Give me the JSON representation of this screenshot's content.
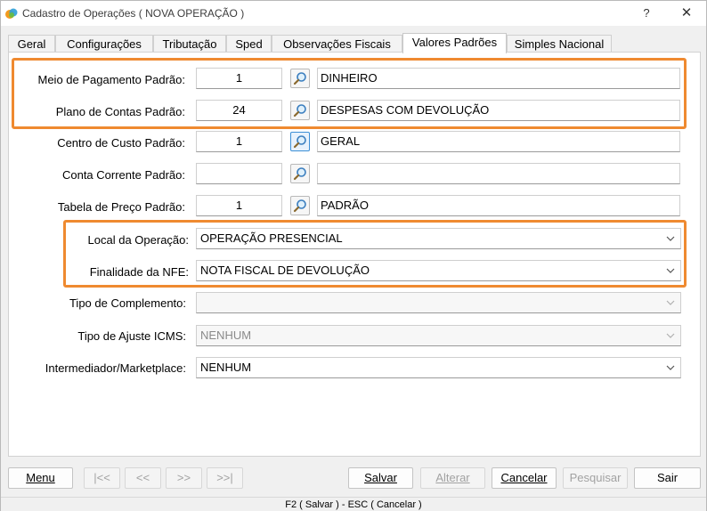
{
  "window": {
    "title": "Cadastro de Operações ( NOVA OPERAÇÃO )",
    "help_label": "?",
    "close_label": "✕"
  },
  "tabs": [
    {
      "label": "Geral"
    },
    {
      "label": "Configurações"
    },
    {
      "label": "Tributação"
    },
    {
      "label": "Sped"
    },
    {
      "label": "Observações Fiscais"
    },
    {
      "label": "Valores Padrões",
      "active": true
    },
    {
      "label": "Simples Nacional"
    }
  ],
  "fields": {
    "meio_pagamento": {
      "label": "Meio de Pagamento Padrão:",
      "code": "1",
      "description": "DINHEIRO"
    },
    "plano_contas": {
      "label": "Plano de Contas Padrão:",
      "code": "24",
      "description": "DESPESAS COM DEVOLUÇÃO"
    },
    "centro_custo": {
      "label": "Centro de Custo Padrão:",
      "code": "1",
      "description": "GERAL"
    },
    "conta_corrente": {
      "label": "Conta Corrente Padrão:",
      "code": "",
      "description": ""
    },
    "tabela_preco": {
      "label": "Tabela de Preço Padrão:",
      "code": "1",
      "description": "PADRÃO"
    }
  },
  "combos": {
    "local_operacao": {
      "label": "Local da Operação:",
      "value": "OPERAÇÃO PRESENCIAL"
    },
    "finalidade_nfe": {
      "label": "Finalidade da NFE:",
      "value": "NOTA FISCAL DE DEVOLUÇÃO"
    },
    "tipo_complemento": {
      "label": "Tipo de Complemento:",
      "value": ""
    },
    "tipo_ajuste_icms": {
      "label": "Tipo de Ajuste ICMS:",
      "value": "NENHUM"
    },
    "intermediador": {
      "label": "Intermediador/Marketplace:",
      "value": "NENHUM"
    }
  },
  "buttons": {
    "menu": "Menu",
    "first": "|<<",
    "prev": "<<",
    "next": ">>",
    "last": ">>|",
    "salvar": "Salvar",
    "alterar": "Alterar",
    "cancelar": "Cancelar",
    "pesquisar": "Pesquisar",
    "sair": "Sair"
  },
  "status_bar": "F2 ( Salvar )  -  ESC ( Cancelar )",
  "colors": {
    "highlight": "#ef8a30",
    "focus": "#3c8fd6"
  },
  "icons": {
    "search": "magnifier-icon",
    "app": "app-logo-icon"
  }
}
